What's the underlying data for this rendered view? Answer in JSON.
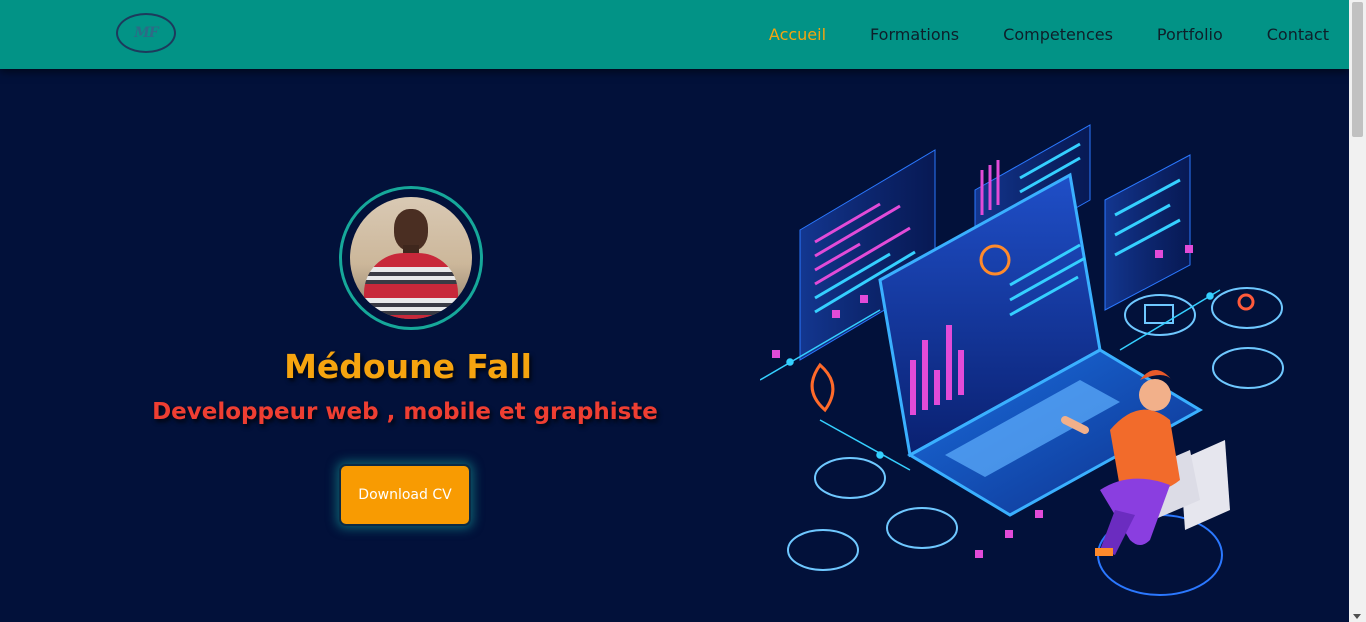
{
  "header": {
    "logo_text": "MF",
    "nav": [
      {
        "label": "Accueil",
        "active": true
      },
      {
        "label": "Formations",
        "active": false
      },
      {
        "label": "Competences",
        "active": false
      },
      {
        "label": "Portfolio",
        "active": false
      },
      {
        "label": "Contact",
        "active": false
      }
    ]
  },
  "hero": {
    "name": "Médoune Fall",
    "title": "Developpeur web , mobile et graphiste",
    "cta_label": "Download CV"
  },
  "colors": {
    "navbar": "#029386",
    "background": "#02113a",
    "accent_orange": "#f6a40f",
    "accent_red": "#ee3e32",
    "button": "#f89b02"
  }
}
